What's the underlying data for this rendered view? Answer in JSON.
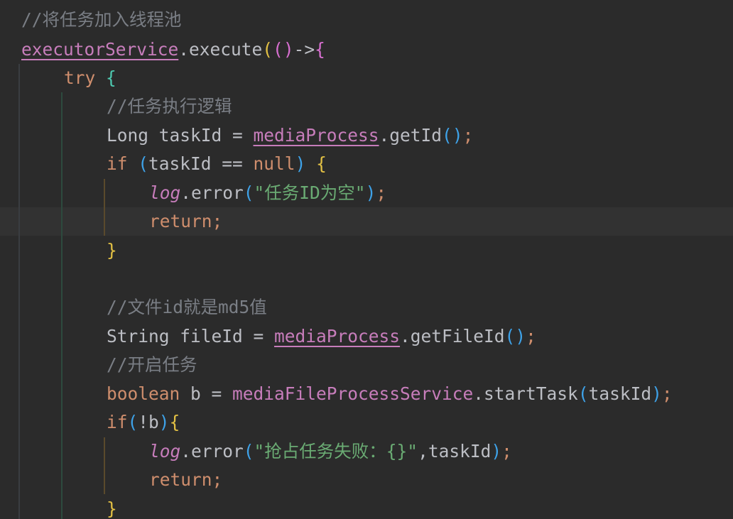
{
  "editor": {
    "lines": [
      {
        "tokens": [
          {
            "t": "//将任务加入线程池",
            "c": "tok-comment"
          }
        ]
      },
      {
        "tokens": [
          {
            "t": "executorService",
            "c": "tok-field"
          },
          {
            "t": ".execute",
            "c": "tok-plain"
          },
          {
            "t": "(",
            "c": "p1"
          },
          {
            "t": "(",
            "c": "p2"
          },
          {
            "t": ")",
            "c": "p2"
          },
          {
            "t": "->",
            "c": "tok-plain"
          },
          {
            "t": "{",
            "c": "p2"
          }
        ]
      },
      {
        "tokens": [
          {
            "t": "try ",
            "c": "tok-keyword"
          },
          {
            "t": "{",
            "c": "p4"
          }
        ]
      },
      {
        "tokens": [
          {
            "t": "//任务执行逻辑",
            "c": "tok-comment"
          }
        ]
      },
      {
        "tokens": [
          {
            "t": "Long taskId = ",
            "c": "tok-plain"
          },
          {
            "t": "mediaProcess",
            "c": "tok-field"
          },
          {
            "t": ".getId",
            "c": "tok-plain"
          },
          {
            "t": "(",
            "c": "p3"
          },
          {
            "t": ")",
            "c": "p3"
          },
          {
            "t": ";",
            "c": "tok-keyword"
          }
        ]
      },
      {
        "tokens": [
          {
            "t": "if ",
            "c": "tok-keyword"
          },
          {
            "t": "(",
            "c": "p3"
          },
          {
            "t": "taskId == ",
            "c": "tok-plain"
          },
          {
            "t": "null",
            "c": "tok-keyword"
          },
          {
            "t": ") ",
            "c": "p3"
          },
          {
            "t": "{",
            "c": "p1"
          }
        ]
      },
      {
        "tokens": [
          {
            "t": "log",
            "c": "tok-static"
          },
          {
            "t": ".error",
            "c": "tok-plain"
          },
          {
            "t": "(",
            "c": "p3"
          },
          {
            "t": "\"任务ID为空\"",
            "c": "tok-string"
          },
          {
            "t": ")",
            "c": "p3"
          },
          {
            "t": ";",
            "c": "tok-keyword"
          }
        ]
      },
      {
        "tokens": [
          {
            "t": "return;",
            "c": "tok-keyword"
          }
        ]
      },
      {
        "tokens": [
          {
            "t": "}",
            "c": "p1"
          }
        ]
      },
      {
        "tokens": []
      },
      {
        "tokens": [
          {
            "t": "//文件id就是md5值",
            "c": "tok-comment"
          }
        ]
      },
      {
        "tokens": [
          {
            "t": "String fileId = ",
            "c": "tok-plain"
          },
          {
            "t": "mediaProcess",
            "c": "tok-field"
          },
          {
            "t": ".getFileId",
            "c": "tok-plain"
          },
          {
            "t": "(",
            "c": "p3"
          },
          {
            "t": ")",
            "c": "p3"
          },
          {
            "t": ";",
            "c": "tok-keyword"
          }
        ]
      },
      {
        "tokens": [
          {
            "t": "//开启任务",
            "c": "tok-comment"
          }
        ]
      },
      {
        "tokens": [
          {
            "t": "boolean ",
            "c": "tok-keyword"
          },
          {
            "t": "b = ",
            "c": "tok-plain"
          },
          {
            "t": "mediaFileProcessService",
            "c": "tok-field-plain"
          },
          {
            "t": ".startTask",
            "c": "tok-plain"
          },
          {
            "t": "(",
            "c": "p3"
          },
          {
            "t": "taskId",
            "c": "tok-plain"
          },
          {
            "t": ")",
            "c": "p3"
          },
          {
            "t": ";",
            "c": "tok-keyword"
          }
        ]
      },
      {
        "tokens": [
          {
            "t": "if",
            "c": "tok-keyword"
          },
          {
            "t": "(",
            "c": "p3"
          },
          {
            "t": "!b",
            "c": "tok-plain"
          },
          {
            "t": ")",
            "c": "p3"
          },
          {
            "t": "{",
            "c": "p1"
          }
        ]
      },
      {
        "tokens": [
          {
            "t": "log",
            "c": "tok-static"
          },
          {
            "t": ".error",
            "c": "tok-plain"
          },
          {
            "t": "(",
            "c": "p3"
          },
          {
            "t": "\"抢占任务失败：{}\"",
            "c": "tok-string"
          },
          {
            "t": ",taskId",
            "c": "tok-plain"
          },
          {
            "t": ")",
            "c": "p3"
          },
          {
            "t": ";",
            "c": "tok-keyword"
          }
        ]
      },
      {
        "tokens": [
          {
            "t": "return;",
            "c": "tok-keyword"
          }
        ]
      },
      {
        "tokens": [
          {
            "t": "}",
            "c": "p1"
          }
        ]
      }
    ]
  },
  "colors": {
    "background": "#2b2b2b",
    "current_line": "#323232",
    "comment": "#7a7e85",
    "keyword": "#cf8e6d",
    "field": "#c77dbb",
    "string": "#6aab73",
    "plain": "#bcbec4",
    "guide_outer": "#3a3d41",
    "guide_inner_green": "#2f4a3a",
    "guide_inner_gold": "#5c4a2a"
  }
}
